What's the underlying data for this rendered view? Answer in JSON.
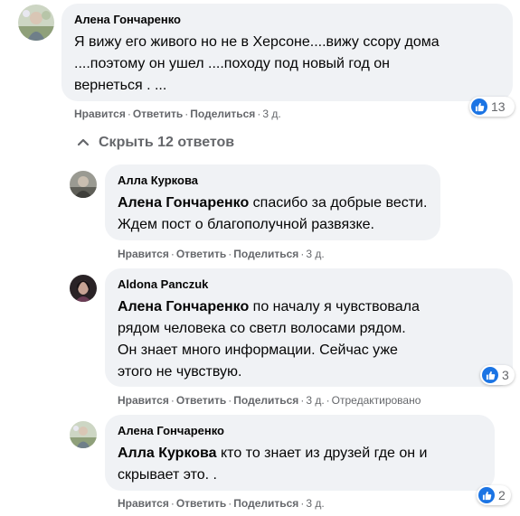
{
  "colors": {
    "bubble": "#f0f2f5",
    "like": "#1b74e4",
    "meta_text": "#65676b"
  },
  "actions": {
    "like": "Нравится",
    "reply": "Ответить",
    "share": "Поделиться",
    "sep": "·"
  },
  "icons": {
    "like_reaction": "thumbs-up-icon",
    "collapse": "chevron-up-icon"
  },
  "main_comment": {
    "author": "Алена Гончаренко",
    "lines": [
      "Я вижу его живого но не в Херсоне....вижу ссору дома",
      "....поэтому он ушел ....походу под новый год он",
      "вернеться . ..."
    ],
    "time": "3 д.",
    "reactions": "13"
  },
  "replies_toggle": "Скрыть 12 ответов",
  "replies": [
    {
      "author": "Алла Куркова",
      "mention": "Алена Гончаренко",
      "line1_rest": " спасибо за добрые вести.",
      "line2": "Ждем пост о благополучной развязке.",
      "time": "3 д."
    },
    {
      "author": "Aldona Panczuk",
      "mention": "Алена Гончаренко",
      "line1_rest": " по началу я чувствовала",
      "line2": "рядом человека со светл волосами рядом.",
      "line3": "Он знает много информации. Сейчас уже",
      "line4": "этого не чувствую.",
      "time": "3 д.",
      "edited": "Отредактировано",
      "reactions": "3"
    },
    {
      "author": "Алена Гончаренко",
      "mention": "Алла Куркова",
      "line1_rest": " кто то знает из друзей где он и",
      "line2": "скрывает это. .",
      "time": "3 д.",
      "reactions": "2"
    }
  ]
}
